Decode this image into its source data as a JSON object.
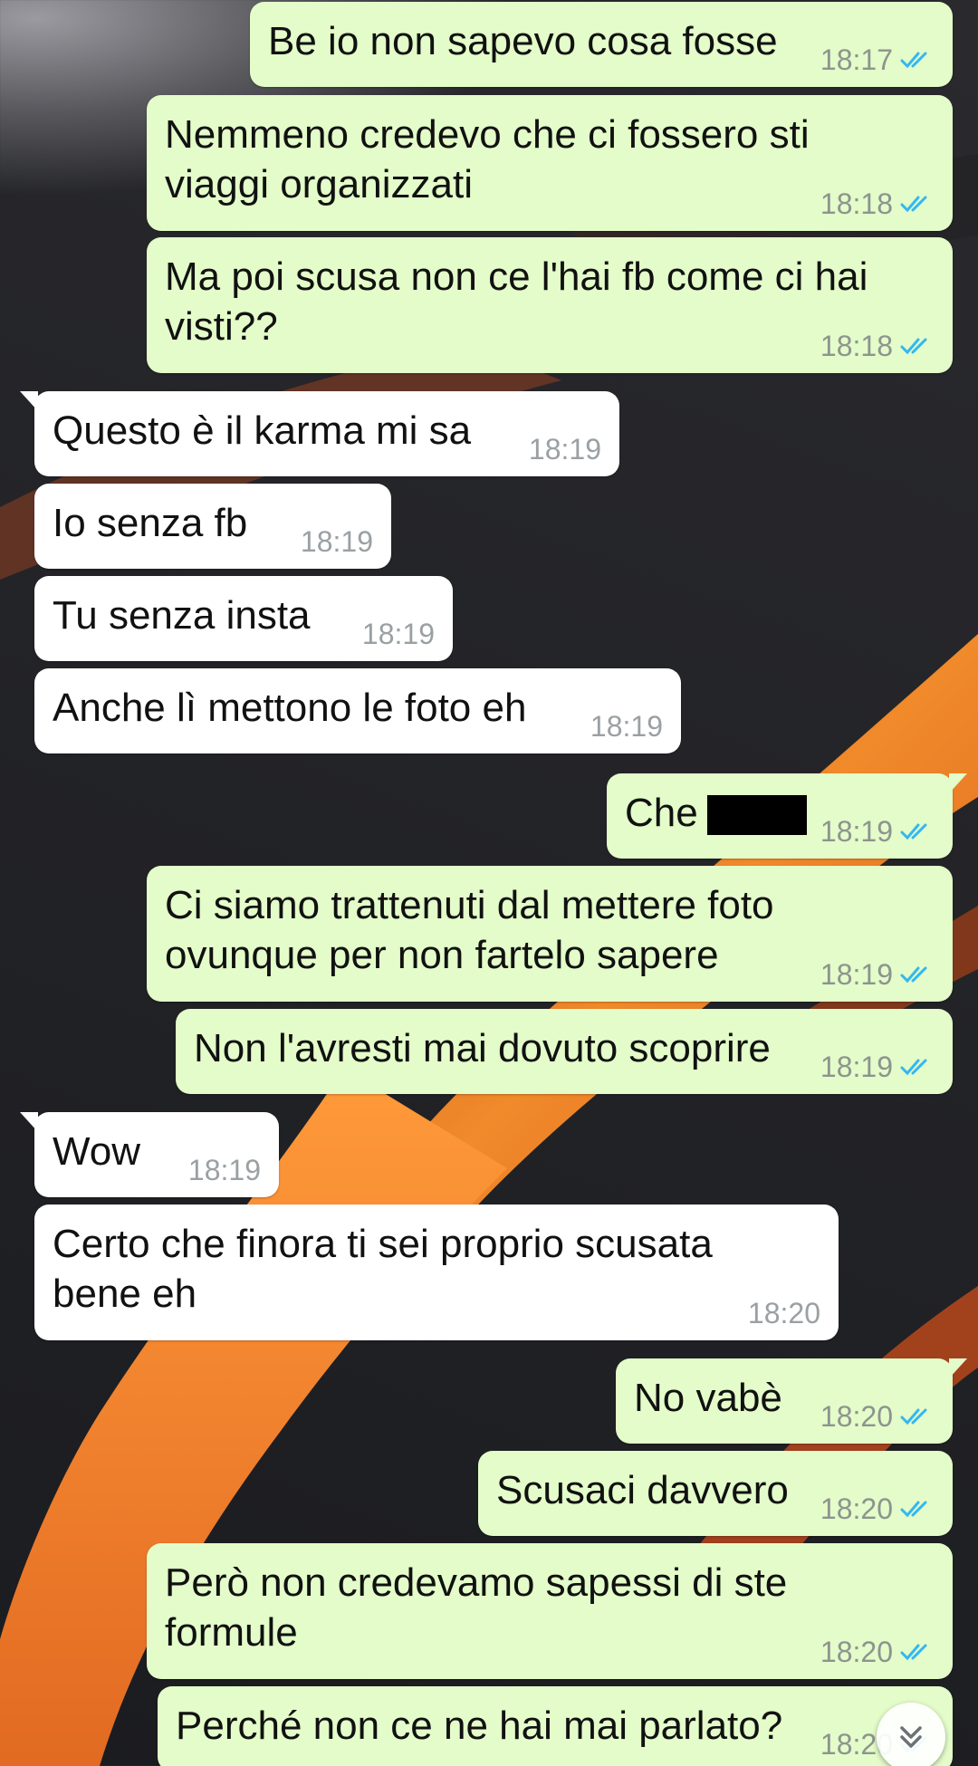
{
  "messages": [
    {
      "dir": "out",
      "text": "Be io non sapevo cosa fosse",
      "time": "18:17",
      "read": true
    },
    {
      "dir": "out",
      "text": "Nemmeno credevo che ci fossero sti\nviaggi organizzati",
      "time": "18:18",
      "read": true
    },
    {
      "dir": "out",
      "text": "Ma poi scusa non ce l'hai fb come ci hai\nvisti??",
      "time": "18:18",
      "read": true
    },
    {
      "dir": "in",
      "text": "Questo è il karma mi sa",
      "time": "18:19"
    },
    {
      "dir": "in",
      "text": "Io senza fb",
      "time": "18:19"
    },
    {
      "dir": "in",
      "text": "Tu senza insta",
      "time": "18:19"
    },
    {
      "dir": "in",
      "text": "Anche lì mettono le foto eh",
      "time": "18:19"
    },
    {
      "dir": "out",
      "text": "Che",
      "time": "18:19",
      "read": true,
      "redacted": true
    },
    {
      "dir": "out",
      "text": "Ci siamo trattenuti dal mettere foto\novunque per non fartelo sapere",
      "time": "18:19",
      "read": true
    },
    {
      "dir": "out",
      "text": "Non l'avresti mai dovuto scoprire",
      "time": "18:19",
      "read": true
    },
    {
      "dir": "in",
      "text": "Wow",
      "time": "18:19"
    },
    {
      "dir": "in",
      "text": "Certo che finora ti sei proprio scusata\nbene eh",
      "time": "18:20"
    },
    {
      "dir": "out",
      "text": "No vabè",
      "time": "18:20",
      "read": true
    },
    {
      "dir": "out",
      "text": "Scusaci davvero",
      "time": "18:20",
      "read": true
    },
    {
      "dir": "out",
      "text": "Però non credevamo sapessi di ste\nformule",
      "time": "18:20",
      "read": true
    },
    {
      "dir": "out",
      "text": "Perché non ce ne hai mai parlato?",
      "time": "18:20",
      "read": true
    }
  ],
  "icons": {
    "read_receipt": "double-check-icon",
    "scroll_down": "chevron-double-down-icon"
  },
  "colors": {
    "outgoing_bubble": "#e3fcc9",
    "incoming_bubble": "#ffffff",
    "read_tick": "#34b7f1",
    "timestamp": "#8d948e"
  }
}
